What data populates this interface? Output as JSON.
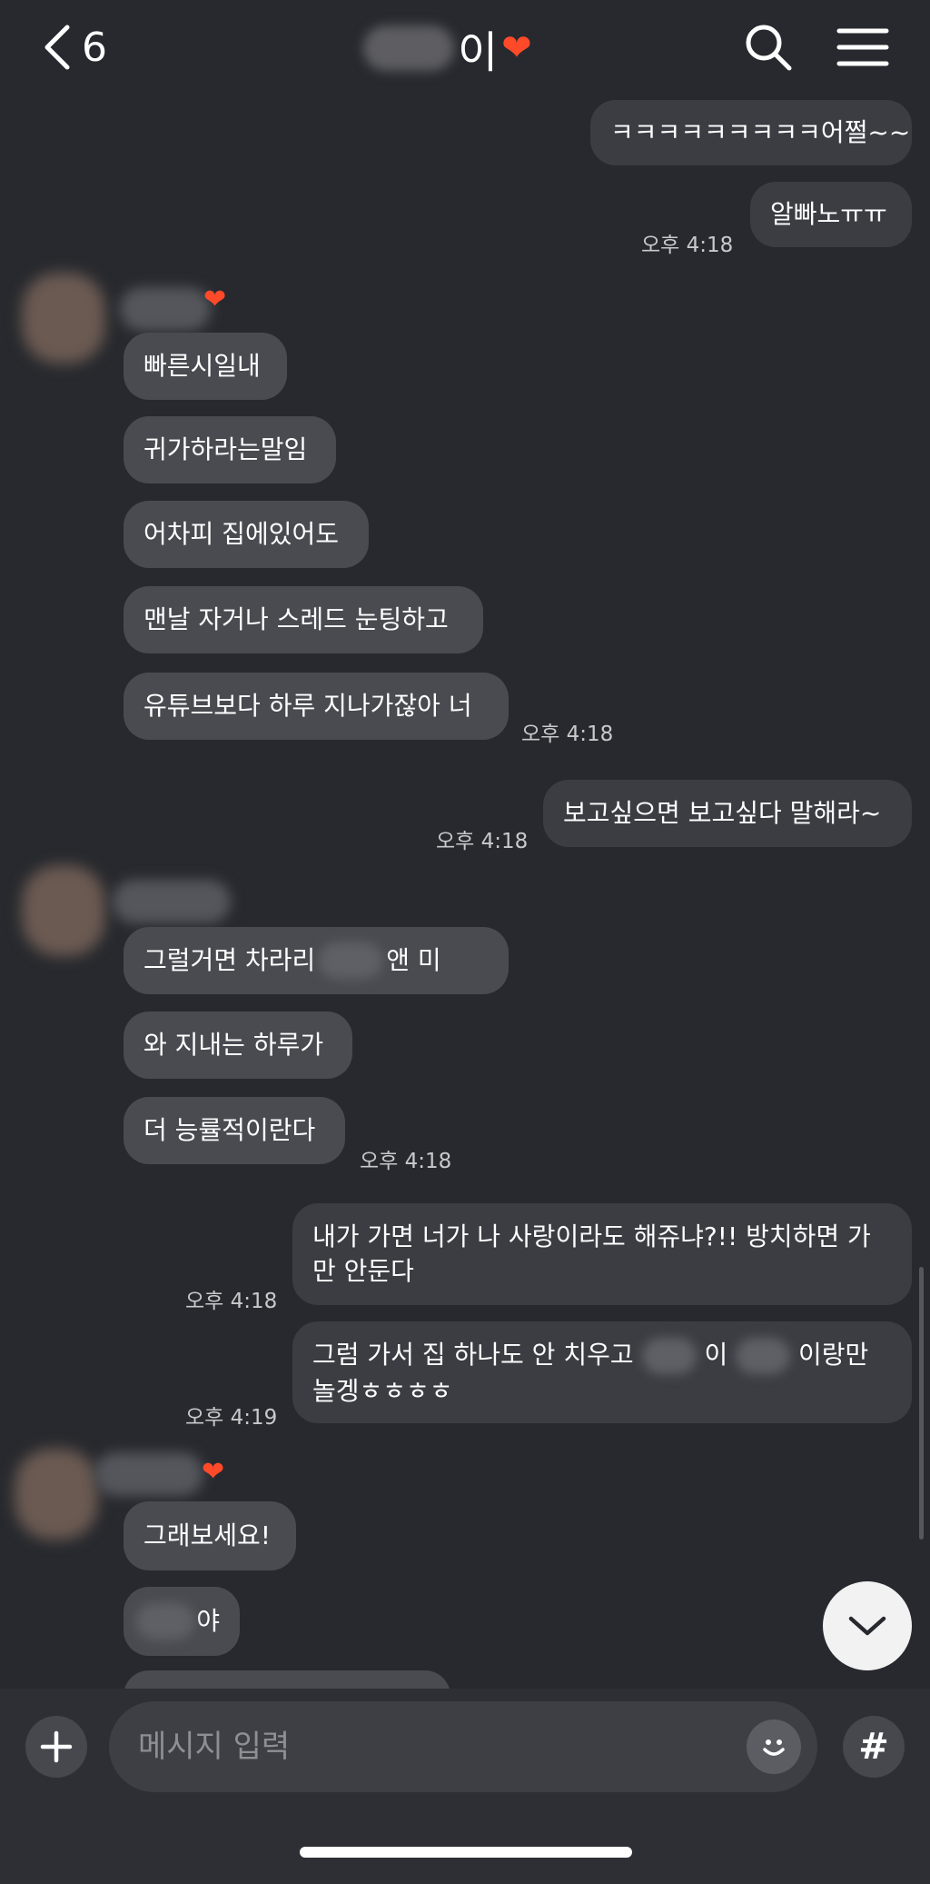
{
  "header": {
    "back_count": "6",
    "title_visible": "이",
    "title_heart": "❤",
    "back_icon": "chevron-left-icon",
    "search_icon": "search-icon",
    "menu_icon": "hamburger-menu-icon"
  },
  "messages": [
    {
      "dir": "out",
      "text": "ㅋㅋㅋㅋㅋㅋㅋㅋㅋ어쩔~~"
    },
    {
      "dir": "out",
      "text": "알빠노ㅠㅠ",
      "time": "오후 4:18"
    },
    {
      "dir": "in",
      "text": "빠른시일내"
    },
    {
      "dir": "in",
      "text": "귀가하라는말임"
    },
    {
      "dir": "in",
      "text": "어차피 집에있어도"
    },
    {
      "dir": "in",
      "text": "맨날 자거나 스레드 눈팅하고"
    },
    {
      "dir": "in",
      "text": "유튜브보다 하루 지나가잖아 너",
      "time": "오후 4:18"
    },
    {
      "dir": "out",
      "text": "보고싶으면 보고싶다 말해라~",
      "time": "오후 4:18"
    },
    {
      "dir": "in",
      "text_a": "그럴거면 차라리",
      "text_b": "앤 미"
    },
    {
      "dir": "in",
      "text": "와 지내는 하루가"
    },
    {
      "dir": "in",
      "text": "더 능률적이란다",
      "time": "오후 4:18"
    },
    {
      "dir": "out",
      "text": "내가 가면 너가 나 사랑이라도 해쥬냐?!! 방치하면 가만 안둔다",
      "time": "오후 4:18"
    },
    {
      "dir": "out",
      "text_a": "그럼 가서 집 하나도 안 치우고",
      "text_b": "이",
      "text_c": "이랑만 놀겡ㅎㅎㅎㅎ",
      "time": "오후 4:19"
    },
    {
      "dir": "in",
      "text": "그래보세요!"
    },
    {
      "dir": "in",
      "text": "야"
    }
  ],
  "input": {
    "placeholder": "메시지 입력",
    "plus_icon": "plus-icon",
    "emoji_icon": "emoji-icon",
    "hash_icon": "hash-icon",
    "hash_label": "#"
  },
  "scroll_button_icon": "chevron-down-icon",
  "colors": {
    "background": "#27292e",
    "incoming_bubble": "#4a4b51",
    "outgoing_bubble": "#3b3d43",
    "heart": "#ff4a2a"
  }
}
